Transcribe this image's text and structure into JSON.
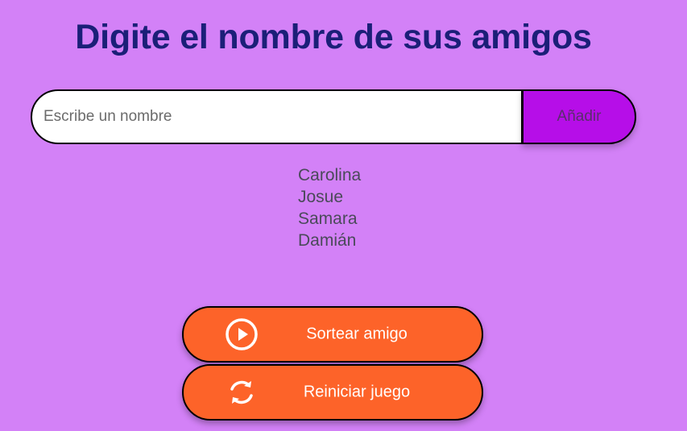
{
  "header": {
    "title": "Digite el nombre de sus amigos"
  },
  "input": {
    "placeholder": "Escribe un nombre",
    "value": ""
  },
  "add_button": {
    "label": "Añadir"
  },
  "friends": [
    "Carolina",
    "Josue",
    "Samara",
    "Damián"
  ],
  "actions": {
    "draw": {
      "label": "Sortear amigo",
      "icon": "play-circle-icon"
    },
    "reset": {
      "label": "Reiniciar juego",
      "icon": "refresh-icon"
    }
  },
  "colors": {
    "background": "#d381f7",
    "title": "#1b1f78",
    "add_button": "#b60ee8",
    "action_button": "#fd6329"
  }
}
